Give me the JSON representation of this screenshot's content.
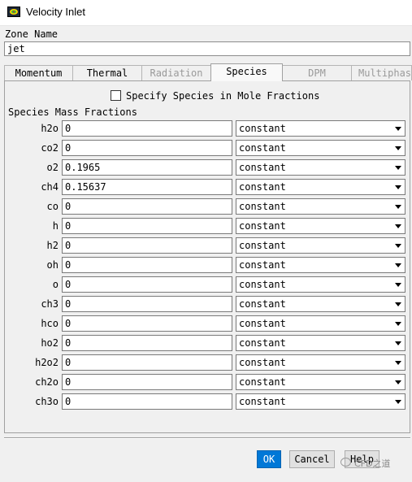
{
  "window": {
    "title": "Velocity Inlet"
  },
  "zone": {
    "label": "Zone Name",
    "value": "jet"
  },
  "tabs": [
    {
      "label": "Momentum",
      "state": "enabled"
    },
    {
      "label": "Thermal",
      "state": "enabled"
    },
    {
      "label": "Radiation",
      "state": "disabled"
    },
    {
      "label": "Species",
      "state": "active"
    },
    {
      "label": "DPM",
      "state": "disabled"
    },
    {
      "label": "Multiphase",
      "state": "disabled"
    }
  ],
  "species": {
    "mole_fraction_label": "Specify Species in Mole Fractions",
    "mole_fraction_checked": false,
    "header": "Species Mass Fractions",
    "rows": [
      {
        "name": "h2o",
        "value": "0",
        "method": "constant"
      },
      {
        "name": "co2",
        "value": "0",
        "method": "constant"
      },
      {
        "name": "o2",
        "value": "0.1965",
        "method": "constant"
      },
      {
        "name": "ch4",
        "value": "0.15637",
        "method": "constant"
      },
      {
        "name": "co",
        "value": "0",
        "method": "constant"
      },
      {
        "name": "h",
        "value": "0",
        "method": "constant"
      },
      {
        "name": "h2",
        "value": "0",
        "method": "constant"
      },
      {
        "name": "oh",
        "value": "0",
        "method": "constant"
      },
      {
        "name": "o",
        "value": "0",
        "method": "constant"
      },
      {
        "name": "ch3",
        "value": "0",
        "method": "constant"
      },
      {
        "name": "hco",
        "value": "0",
        "method": "constant"
      },
      {
        "name": "ho2",
        "value": "0",
        "method": "constant"
      },
      {
        "name": "h2o2",
        "value": "0",
        "method": "constant"
      },
      {
        "name": "ch2o",
        "value": "0",
        "method": "constant"
      },
      {
        "name": "ch3o",
        "value": "0",
        "method": "constant"
      }
    ]
  },
  "buttons": {
    "ok": "OK",
    "cancel": "Cancel",
    "help": "Help"
  },
  "watermark": {
    "text": "CFD之道"
  },
  "colors": {
    "accent": "#0078d7",
    "disabled_text": "#9a9a9a"
  }
}
